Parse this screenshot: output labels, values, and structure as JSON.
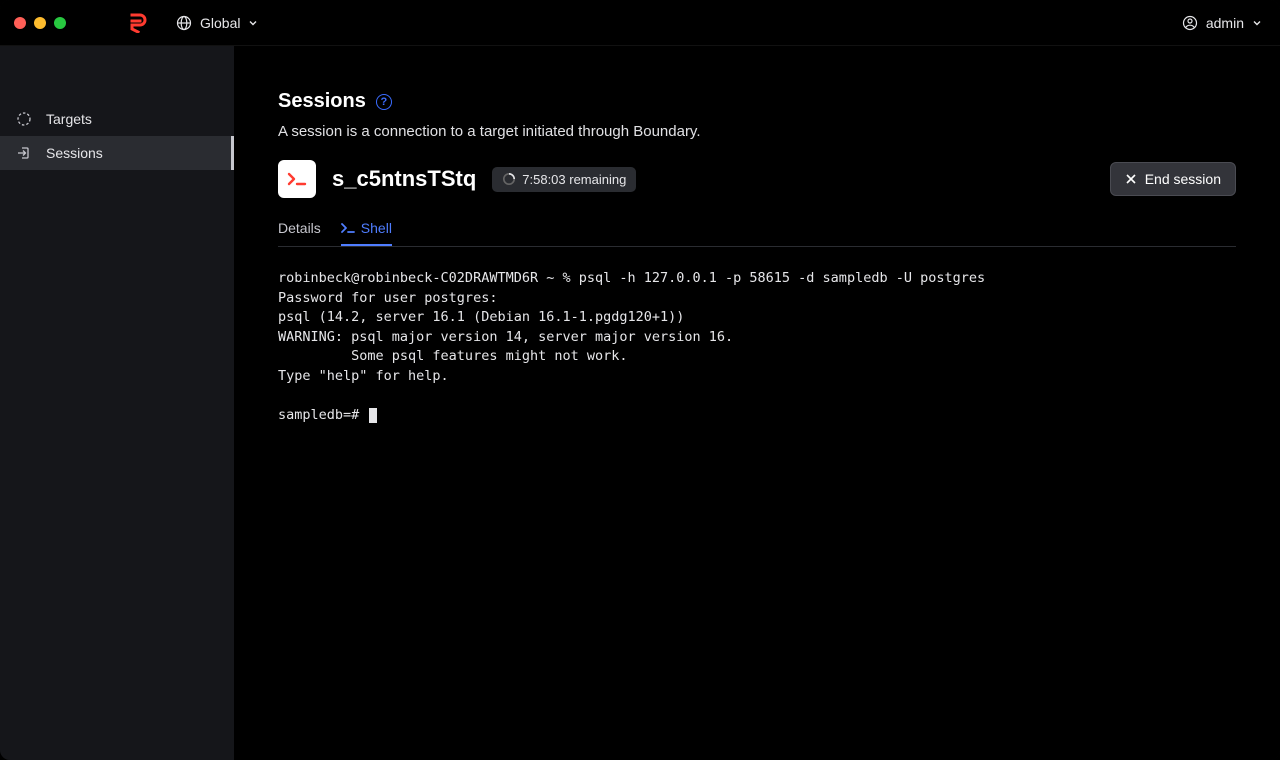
{
  "header": {
    "scope_label": "Global",
    "user_label": "admin"
  },
  "sidebar": {
    "items": [
      {
        "label": "Targets"
      },
      {
        "label": "Sessions"
      }
    ]
  },
  "page": {
    "title": "Sessions",
    "description": "A session is a connection to a target initiated through Boundary."
  },
  "session": {
    "id": "s_c5ntnsTStq",
    "remaining": "7:58:03 remaining",
    "end_label": "End session",
    "tabs": {
      "details": "Details",
      "shell": "Shell"
    }
  },
  "terminal": {
    "lines": [
      "robinbeck@robinbeck-C02DRAWTMD6R ~ % psql -h 127.0.0.1 -p 58615 -d sampledb -U postgres",
      "Password for user postgres:",
      "psql (14.2, server 16.1 (Debian 16.1-1.pgdg120+1))",
      "WARNING: psql major version 14, server major version 16.",
      "         Some psql features might not work.",
      "Type \"help\" for help.",
      "",
      "sampledb=#"
    ]
  }
}
